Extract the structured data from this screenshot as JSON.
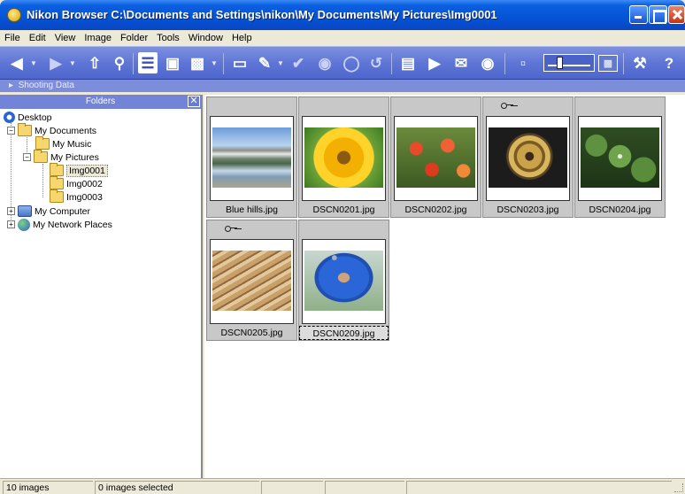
{
  "window": {
    "title": "Nikon Browser C:\\Documents and Settings\\nikon\\My Documents\\My Pictures\\Img0001"
  },
  "menubar": [
    "File",
    "Edit",
    "View",
    "Image",
    "Folder",
    "Tools",
    "Window",
    "Help"
  ],
  "toolbar": {
    "shooting_data_label": "Shooting Data",
    "icons": [
      "back-icon",
      "forward-icon",
      "up-folder-icon",
      "search-icon",
      "folder-tree-icon",
      "transfer-icon",
      "slideshow-icon",
      "new-folder-icon",
      "edit-icon",
      "check-icon",
      "protect-icon",
      "rotate-icon",
      "print-icon",
      "play-icon",
      "mail-icon",
      "web-icon",
      "thumbnail-size-slider",
      "tools-icon",
      "help-icon"
    ]
  },
  "folders": {
    "header": "Folders",
    "tree": [
      {
        "label": "Desktop",
        "icon": "desktop-icon"
      },
      {
        "label": "My Documents",
        "icon": "folder-icon"
      },
      {
        "label": "My Music",
        "icon": "music-folder-icon"
      },
      {
        "label": "My Pictures",
        "icon": "pictures-folder-icon"
      },
      {
        "label": "Img0001",
        "icon": "folder-icon",
        "selected": true
      },
      {
        "label": "Img0002",
        "icon": "folder-icon"
      },
      {
        "label": "Img0003",
        "icon": "folder-icon"
      },
      {
        "label": "My Computer",
        "icon": "computer-icon"
      },
      {
        "label": "My Network Places",
        "icon": "network-icon"
      }
    ]
  },
  "thumbnails": [
    {
      "name": "Blue hills.jpg",
      "protected": false
    },
    {
      "name": "DSCN0201.jpg",
      "protected": false
    },
    {
      "name": "DSCN0202.jpg",
      "protected": false
    },
    {
      "name": "DSCN0203.jpg",
      "protected": true
    },
    {
      "name": "DSCN0204.jpg",
      "protected": false
    },
    {
      "name": "DSCN0205.jpg",
      "protected": true
    },
    {
      "name": "DSCN0209.jpg",
      "protected": false,
      "focused": true
    }
  ],
  "status": {
    "count": "10 images",
    "selected": "0 images selected"
  }
}
